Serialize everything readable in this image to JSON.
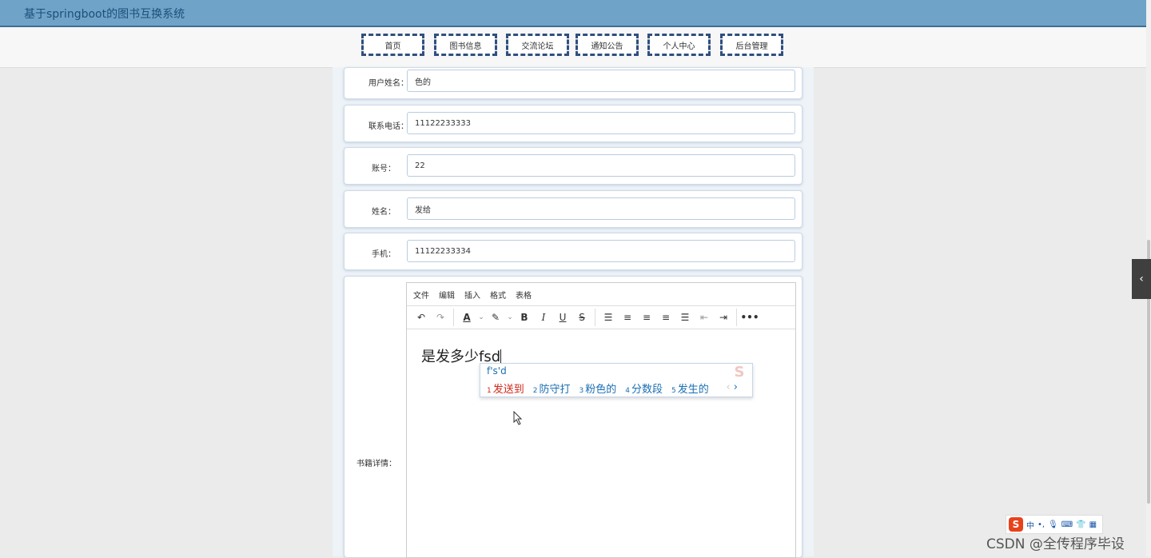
{
  "app": {
    "title": "基于springboot的图书互换系统"
  },
  "nav": {
    "items": [
      {
        "label": "首页"
      },
      {
        "label": "图书信息"
      },
      {
        "label": "交流论坛"
      },
      {
        "label": "通知公告"
      },
      {
        "label": "个人中心"
      },
      {
        "label": "后台管理"
      }
    ]
  },
  "form": {
    "fields": [
      {
        "label": "用户姓名：",
        "value": "色的"
      },
      {
        "label": "联系电话：",
        "value": "11122233333"
      },
      {
        "label": "账号：",
        "value": "22"
      },
      {
        "label": "姓名：",
        "value": "发给"
      },
      {
        "label": "手机：",
        "value": "11122233334"
      }
    ],
    "detail_label": "书籍详情："
  },
  "editor": {
    "menu": [
      "文件",
      "编辑",
      "插入",
      "格式",
      "表格"
    ],
    "toolbar_icons": [
      "undo-icon",
      "redo-icon",
      "font-color-icon",
      "highlight-icon",
      "bold-icon",
      "italic-icon",
      "underline-icon",
      "strikethrough-icon",
      "line-height-icon",
      "align-left-icon",
      "align-center-icon",
      "align-right-icon",
      "align-justify-icon",
      "outdent-icon",
      "indent-icon",
      "more-icon"
    ],
    "content": "是发多少fsd"
  },
  "ime": {
    "composition": "f's'd",
    "candidates": [
      {
        "num": "1",
        "text": "发送到"
      },
      {
        "num": "2",
        "text": "防守打"
      },
      {
        "num": "3",
        "text": "粉色的"
      },
      {
        "num": "4",
        "text": "分数段"
      },
      {
        "num": "5",
        "text": "发生的"
      }
    ],
    "status_mode": "中"
  },
  "watermark": "CSDN @全传程序毕设"
}
